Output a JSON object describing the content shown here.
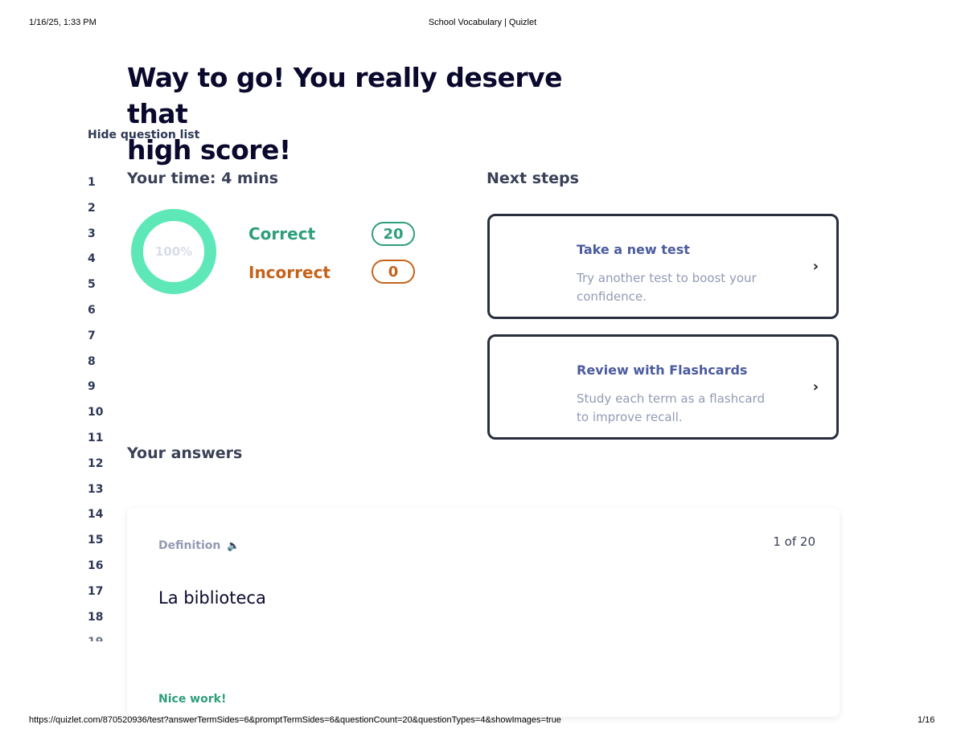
{
  "print_header": {
    "datetime": "1/16/25, 1:33 PM",
    "title": "School Vocabulary | Quizlet"
  },
  "print_footer": {
    "url": "https://quizlet.com/870520936/test?answerTermSides=6&promptTermSides=6&questionCount=20&questionTypes=4&showImages=true",
    "page": "1/16"
  },
  "headline": {
    "line1": "Way to go! You really deserve that",
    "line2": "high score!"
  },
  "question_list": {
    "toggle_label": "Hide question list",
    "numbers": [
      "1",
      "2",
      "3",
      "4",
      "5",
      "6",
      "7",
      "8",
      "9",
      "10",
      "11",
      "12",
      "13",
      "14",
      "15",
      "16",
      "17",
      "18",
      "19"
    ]
  },
  "results": {
    "time_label": "Your time: 4 mins",
    "percent_label": "100%",
    "percent_value": 100,
    "correct_label": "Correct",
    "correct_count": "20",
    "incorrect_label": "Incorrect",
    "incorrect_count": "0",
    "colors": {
      "ring": "#5ee8b8",
      "correct": "#2f9e7a",
      "incorrect": "#c4631a"
    }
  },
  "next_steps": {
    "title": "Next steps",
    "cards": [
      {
        "title": "Take a new test",
        "description": "Try another test to boost your confidence.",
        "icon": "chevron-right-icon"
      },
      {
        "title": "Review with Flashcards",
        "description": "Study each term as a flashcard to improve recall.",
        "icon": "chevron-right-icon"
      }
    ]
  },
  "answers": {
    "title": "Your answers",
    "item": {
      "side_label": "Definition",
      "audio_icon": "speaker-icon",
      "counter": "1 of 20",
      "prompt": "La biblioteca",
      "feedback": "Nice work!"
    }
  }
}
